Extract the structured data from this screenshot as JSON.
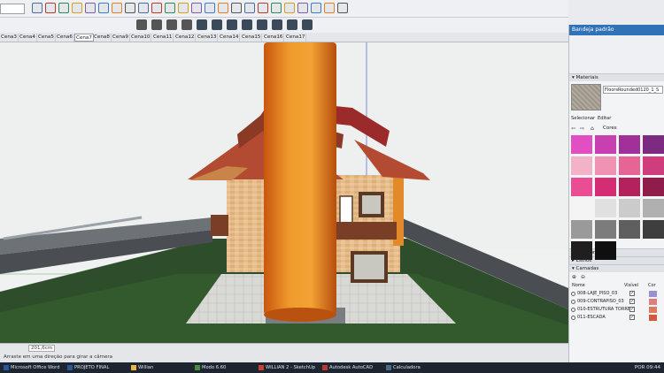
{
  "toolbar": {
    "scene_select": "",
    "icons_row1": [
      "select-icon",
      "eraser-icon",
      "paint-icon",
      "line-icon",
      "arc-icon",
      "rectangle-icon",
      "pushpull-icon",
      "move-icon",
      "rotate-icon",
      "offset-icon",
      "tape-icon",
      "text-icon",
      "axes-icon",
      "orbit-icon",
      "pan-icon",
      "zoom-icon",
      "zoom-extents-icon",
      "walk-icon",
      "lookaround-icon",
      "section-icon",
      "shadow-icon",
      "fog-icon",
      "sandbox-icon",
      "style-icon"
    ],
    "icons_row2": [
      "section-plane-icon",
      "display-section-icon",
      "xray-icon",
      "wireframe-icon",
      "hidden-line-icon",
      "shaded-icon",
      "textured-icon",
      "monochrome-icon",
      "iso-icon",
      "top-icon",
      "front-icon",
      "right-icon"
    ]
  },
  "scenes": [
    "Cena3",
    "Cena4",
    "Cena5",
    "Cena6",
    "Cena7",
    "Cena8",
    "Cena9",
    "Cena10",
    "Cena11",
    "Cena12",
    "Cena13",
    "Cena14",
    "Cena15",
    "Cena16",
    "Cena17"
  ],
  "active_scene": "Cena7",
  "status": {
    "measure_label": "",
    "measure_value": "201,6cm",
    "hint": "Arraste em uma direção para girar a câmera"
  },
  "panel": {
    "title": "Bandeja padrão",
    "materials_header": "Materiais",
    "material_name": "FloorsRounded0120_1_S",
    "tab_select": "Selecionar",
    "tab_edit": "Editar",
    "library": "Cores",
    "swatch_colors": [
      "#e14fc2",
      "#c83fb0",
      "#a23099",
      "#7d2a82",
      "#f2b3c8",
      "#ef92b4",
      "#e76596",
      "#cf3d7c",
      "#ea4d93",
      "#d42d73",
      "#b5215d",
      "#8f1c4a",
      "#f4f4f4",
      "#e0e0e0",
      "#cbcbcb",
      "#b0b0b0",
      "#9a9a9a",
      "#7c7c7c",
      "#5f5f5f",
      "#3e3e3e",
      "#1f1f1f",
      "#0f0f0f"
    ],
    "components": "Componentes",
    "styles": "Estilos",
    "layers": "Camadas",
    "col_name": "Nome",
    "col_visible": "Visível",
    "col_color": "Cor",
    "layer_rows": [
      {
        "name": "008-LAJE_PISO_03",
        "color": "#9c8fd0"
      },
      {
        "name": "009-CONTRAPISO_03",
        "color": "#e07d7d"
      },
      {
        "name": "010-ESTRUTURA TORRE",
        "color": "#e07a5a"
      },
      {
        "name": "011-ESCADA",
        "color": "#d9553c"
      }
    ]
  },
  "taskbar": [
    {
      "label": "Microsoft Office Word",
      "color": "#2b5797"
    },
    {
      "label": "PROJETO FINAL",
      "color": "#2b5797"
    },
    {
      "label": "Willian",
      "color": "#e8b64a"
    },
    {
      "label": "Modo 6.60",
      "color": "#4a8a3a"
    },
    {
      "label": "WILLIAN 2 - SketchUp",
      "color": "#c84030"
    },
    {
      "label": "Autodesk AutoCAD",
      "color": "#b83a2a"
    },
    {
      "label": "Calculadora",
      "color": "#4a6a8a"
    }
  ],
  "tray": {
    "lang": "POR",
    "time": "09:44"
  }
}
